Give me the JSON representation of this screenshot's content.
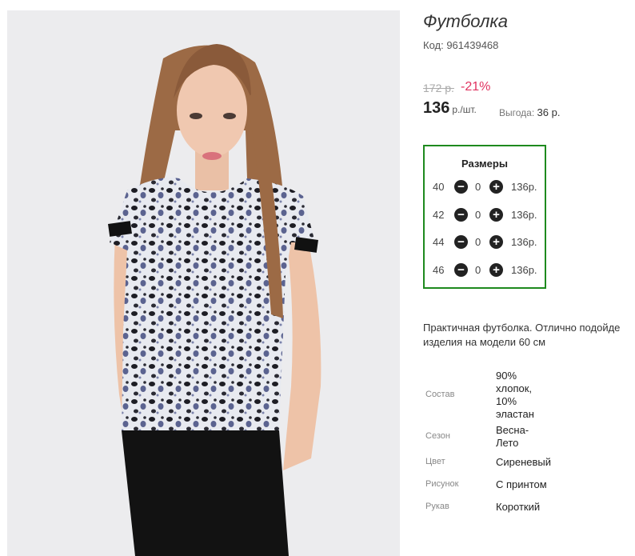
{
  "product": {
    "title": "Футболка",
    "code": "Код: 961439468",
    "old_price": "172 р.",
    "discount": "-21%",
    "price": "136",
    "unit": "р./шт.",
    "benefit_label": "Выгода:",
    "benefit_value": "36 р."
  },
  "sizes": {
    "title": "Размеры",
    "rows": [
      {
        "size": "40",
        "qty": "0",
        "price": "136р."
      },
      {
        "size": "42",
        "qty": "0",
        "price": "136р."
      },
      {
        "size": "44",
        "qty": "0",
        "price": "136р."
      },
      {
        "size": "46",
        "qty": "0",
        "price": "136р."
      }
    ],
    "minus_icon": "minus-circle-icon",
    "plus_icon": "plus-circle-icon",
    "border_color": "#1e8a1e"
  },
  "description": {
    "line1": "Практичная футболка. Отлично подойде",
    "line2": "изделия на модели 60 см"
  },
  "specs": [
    {
      "label": "Состав",
      "value_lines": [
        "90%",
        "хлопок,",
        "10%",
        "эластан"
      ]
    },
    {
      "label": "Сезон",
      "value_lines": [
        "Весна-",
        "Лето"
      ]
    },
    {
      "label": "Цвет",
      "value_lines": [
        "Сиреневый"
      ]
    },
    {
      "label": "Рисунок",
      "value_lines": [
        "С принтом"
      ]
    },
    {
      "label": "Рукав",
      "value_lines": [
        "Короткий"
      ]
    }
  ],
  "colors": {
    "discount": "#e0325f",
    "photo_bg": "#ececee"
  }
}
